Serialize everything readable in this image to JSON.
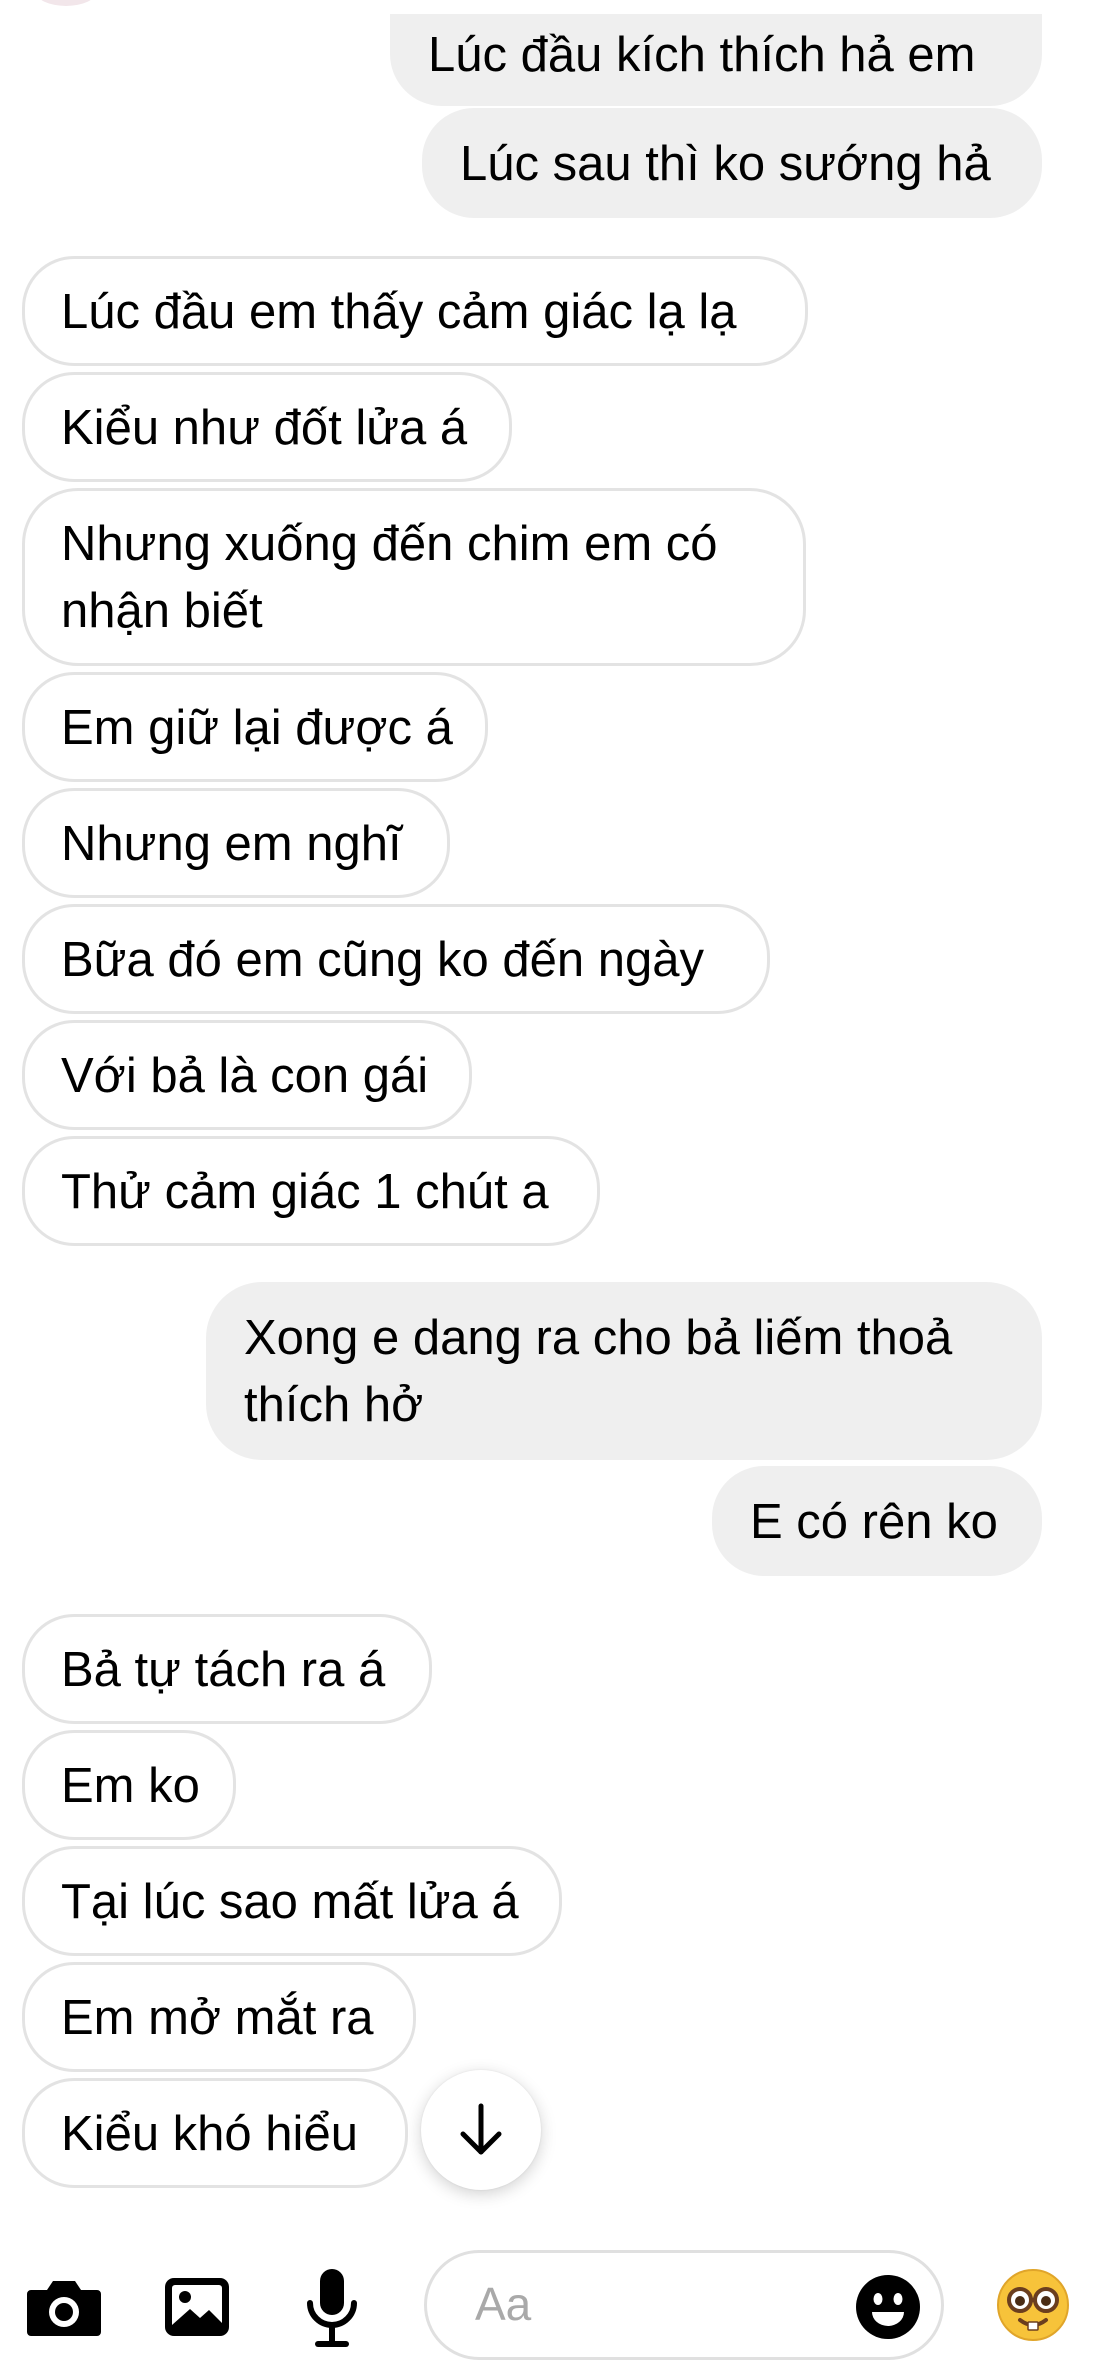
{
  "messages": {
    "outgoing_1": "Lúc đầu kích thích hả em",
    "outgoing_2": "Lúc sau thì ko sướng hả",
    "incoming_1": "Lúc đầu em thấy cảm giác lạ lạ",
    "incoming_2": "Kiểu như đốt lửa á",
    "incoming_3": "Nhưng xuống đến chim em có nhận biết",
    "incoming_4": "Em giữ lại được á",
    "incoming_5": "Nhưng em nghĩ",
    "incoming_6": "Bữa đó em cũng ko đến ngày",
    "incoming_7": "Với bả là con gái",
    "incoming_8": "Thử cảm giác 1 chút a",
    "outgoing_3": "Xong e dang ra cho bả liếm thoả thích hở",
    "outgoing_4": "E có rên ko",
    "incoming_9": "Bả tự tách ra á",
    "incoming_10": "Em ko",
    "incoming_11": "Tại lúc sao mất lửa á",
    "incoming_12": "Em mở mắt ra",
    "incoming_13": "Kiểu khó hiểu"
  },
  "composer": {
    "placeholder": "Aa",
    "icons": [
      "camera-icon",
      "gallery-icon",
      "microphone-icon",
      "smiley-icon",
      "nerd-face-emoji"
    ]
  },
  "scroll_down_icon": "arrow-down-icon",
  "colors": {
    "outgoing_bubble": "#efefef",
    "incoming_border": "#e3e3e3",
    "icon": "#000000"
  }
}
